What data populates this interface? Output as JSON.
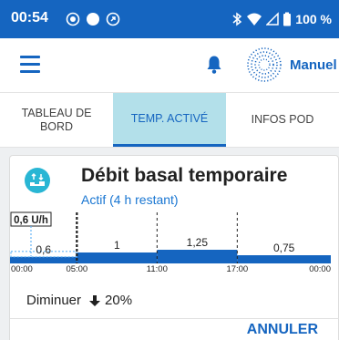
{
  "status_bar": {
    "time": "00:54",
    "battery": "100 %"
  },
  "app_bar": {
    "mode": "Manuel"
  },
  "tabs": [
    {
      "label": "TABLEAU DE BORD",
      "active": false
    },
    {
      "label": "TEMP. ACTIVÉ",
      "active": true
    },
    {
      "label": "INFOS POD",
      "active": false
    }
  ],
  "card": {
    "title": "Débit basal temporaire",
    "status": "Actif (4 h restant)",
    "change_label": "Diminuer",
    "change_value": "20%",
    "cancel_label": "ANNULER"
  },
  "chart_data": {
    "type": "bar",
    "current_rate_label": "0,6 U/h",
    "segments": [
      {
        "start": "00:00",
        "end": "05:00",
        "value": 0.6,
        "label": "0,6",
        "temporary": true
      },
      {
        "start": "05:00",
        "end": "11:00",
        "value": 1,
        "label": "1",
        "temporary": false
      },
      {
        "start": "11:00",
        "end": "17:00",
        "value": 1.25,
        "label": "1,25",
        "temporary": false
      },
      {
        "start": "17:00",
        "end": "24:00",
        "value": 0.75,
        "label": "0,75",
        "temporary": false
      }
    ],
    "x_ticks": [
      "00:00",
      "05:00",
      "11:00",
      "17:00",
      "00:00"
    ],
    "colors": {
      "bar": "#1565c0",
      "temp_outline": "#64b5f6"
    }
  },
  "colors": {
    "primary": "#1565c0",
    "active_tab_bg": "#b3e0ea",
    "icon_bg": "#29b6d4"
  }
}
